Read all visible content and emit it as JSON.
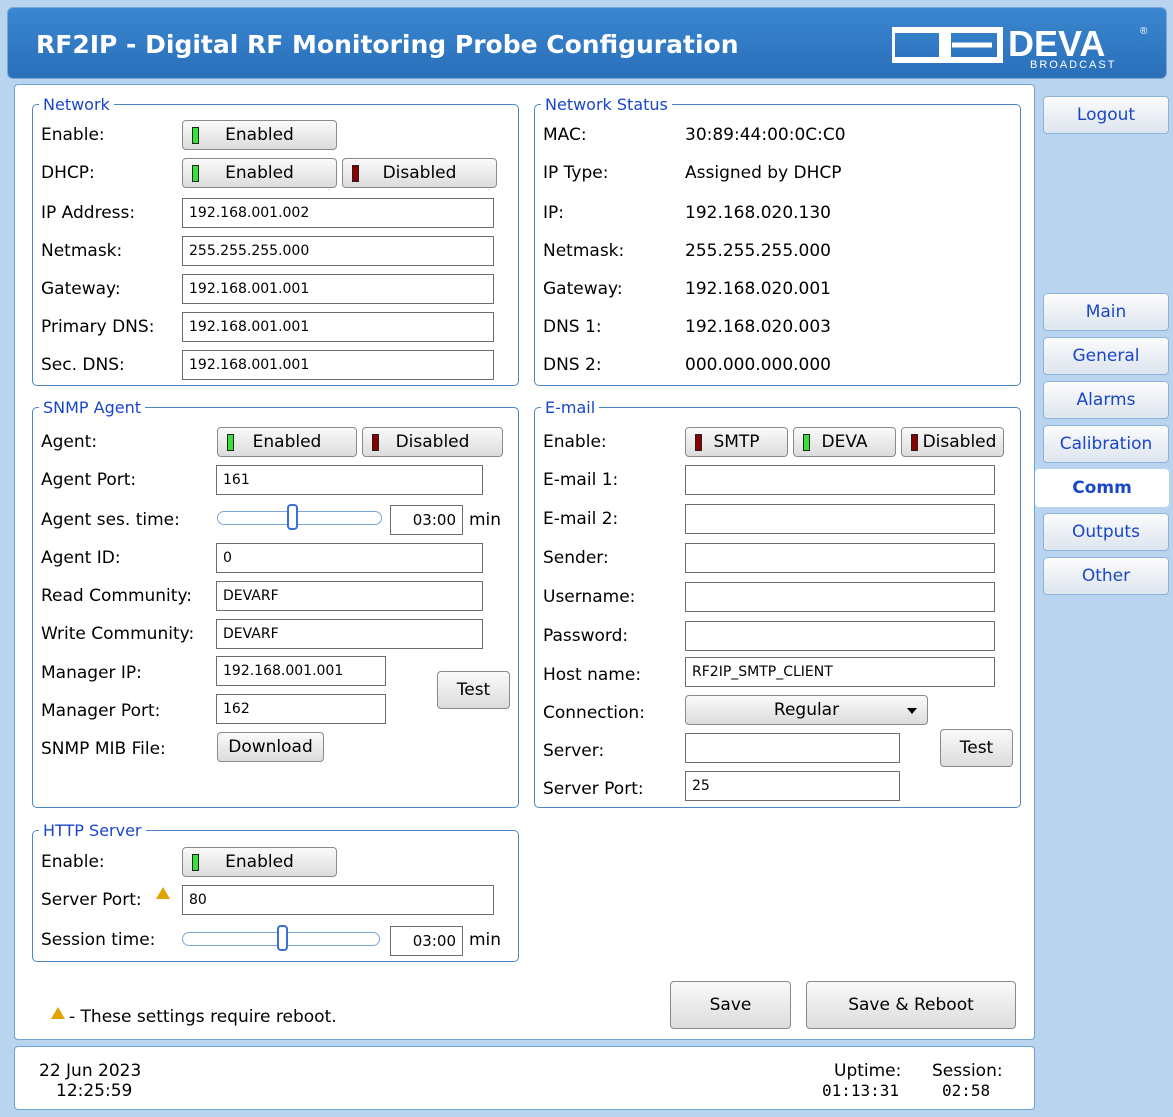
{
  "header": {
    "title": "RF2IP - Digital RF Monitoring Probe Configuration",
    "logo_text": "DEVA",
    "logo_sub": "BROADCAST"
  },
  "network": {
    "legend": "Network",
    "enable_label": "Enable:",
    "enable_btn": "Enabled",
    "dhcp_label": "DHCP:",
    "dhcp_enabled": "Enabled",
    "dhcp_disabled": "Disabled",
    "ip_label": "IP Address:",
    "ip": "192.168.001.002",
    "netmask_label": "Netmask:",
    "netmask": "255.255.255.000",
    "gateway_label": "Gateway:",
    "gateway": "192.168.001.001",
    "pdns_label": "Primary DNS:",
    "pdns": "192.168.001.001",
    "sdns_label": "Sec. DNS:",
    "sdns": "192.168.001.001"
  },
  "status": {
    "legend": "Network Status",
    "rows": [
      {
        "label": "MAC:",
        "value": "30:89:44:00:0C:C0"
      },
      {
        "label": "IP Type:",
        "value": "Assigned by DHCP"
      },
      {
        "label": "IP:",
        "value": "192.168.020.130"
      },
      {
        "label": "Netmask:",
        "value": "255.255.255.000"
      },
      {
        "label": "Gateway:",
        "value": "192.168.020.001"
      },
      {
        "label": "DNS 1:",
        "value": "192.168.020.003"
      },
      {
        "label": "DNS 2:",
        "value": "000.000.000.000"
      }
    ]
  },
  "snmp": {
    "legend": "SNMP Agent",
    "agent_label": "Agent:",
    "agent_enabled": "Enabled",
    "agent_disabled": "Disabled",
    "port_label": "Agent Port:",
    "port": "161",
    "ses_label": "Agent ses. time:",
    "ses_time": "03:00",
    "ses_unit": "min",
    "ses_level": 0.45,
    "id_label": "Agent ID:",
    "id": "0",
    "read_label": "Read Community:",
    "read": "DEVARF",
    "write_label": "Write Community:",
    "write": "DEVARF",
    "mgr_ip_label": "Manager IP:",
    "mgr_ip": "192.168.001.001",
    "mgr_port_label": "Manager Port:",
    "mgr_port": "162",
    "test_btn": "Test",
    "mib_label": "SNMP MIB File:",
    "mib_btn": "Download"
  },
  "email": {
    "legend": "E-mail",
    "enable_label": "Enable:",
    "smtp_btn": "SMTP",
    "deva_btn": "DEVA",
    "disabled_btn": "Disabled",
    "email1_label": "E-mail 1:",
    "email1": "",
    "email2_label": "E-mail 2:",
    "email2": "",
    "sender_label": "Sender:",
    "sender": "",
    "user_label": "Username:",
    "user": "",
    "pass_label": "Password:",
    "pass": "",
    "host_label": "Host name:",
    "host": "RF2IP_SMTP_CLIENT",
    "conn_label": "Connection:",
    "conn": "Regular",
    "server_label": "Server:",
    "server": "",
    "test_btn": "Test",
    "sport_label": "Server Port:",
    "sport": "25"
  },
  "http": {
    "legend": "HTTP Server",
    "enable_label": "Enable:",
    "enable_btn": "Enabled",
    "port_label": "Server Port:",
    "port": "80",
    "ses_label": "Session time:",
    "ses_time": "03:00",
    "ses_unit": "min",
    "ses_level": 0.5
  },
  "note": "- These settings require reboot.",
  "actions": {
    "save": "Save",
    "save_reboot": "Save & Reboot"
  },
  "nav": {
    "logout": "Logout",
    "items": [
      "Main",
      "General",
      "Alarms",
      "Calibration",
      "Comm",
      "Outputs",
      "Other"
    ],
    "active": "Comm"
  },
  "footer": {
    "date": "22 Jun 2023",
    "time": "12:25:59",
    "uptime_label": "Uptime:",
    "uptime": "01:13:31",
    "session_label": "Session:",
    "session": "02:58"
  },
  "colors": {
    "header": "#2a6fb9",
    "led_on": "#39e039",
    "led_off": "#8a0000",
    "accent": "#1a46c8"
  }
}
